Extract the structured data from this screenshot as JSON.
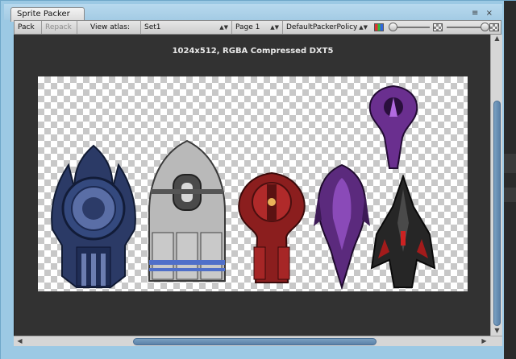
{
  "window": {
    "tab_title": "Sprite Packer"
  },
  "toolbar": {
    "pack_label": "Pack",
    "repack_label": "Repack",
    "view_atlas_label": "View atlas:",
    "atlas_select_value": "Set1",
    "page_select_value": "Page 1",
    "policy_select_value": "DefaultPackerPolicy"
  },
  "atlas_info": "1024x512, RGBA Compressed DXT5",
  "icons": {
    "color_mode": "rgb-swatch-icon",
    "alpha_mode": "checker-swatch-icon",
    "menu": "tab-menu-icon",
    "close": "tab-close-icon"
  },
  "colors": {
    "canvas": "#323232",
    "window_frame": "#9cc9e4",
    "scroll_thumb": "#6a90b6"
  },
  "sprites": [
    {
      "name": "blue-ship"
    },
    {
      "name": "silver-ship"
    },
    {
      "name": "red-ship"
    },
    {
      "name": "purple-ship"
    },
    {
      "name": "purple-small-ship"
    },
    {
      "name": "black-ship"
    }
  ]
}
